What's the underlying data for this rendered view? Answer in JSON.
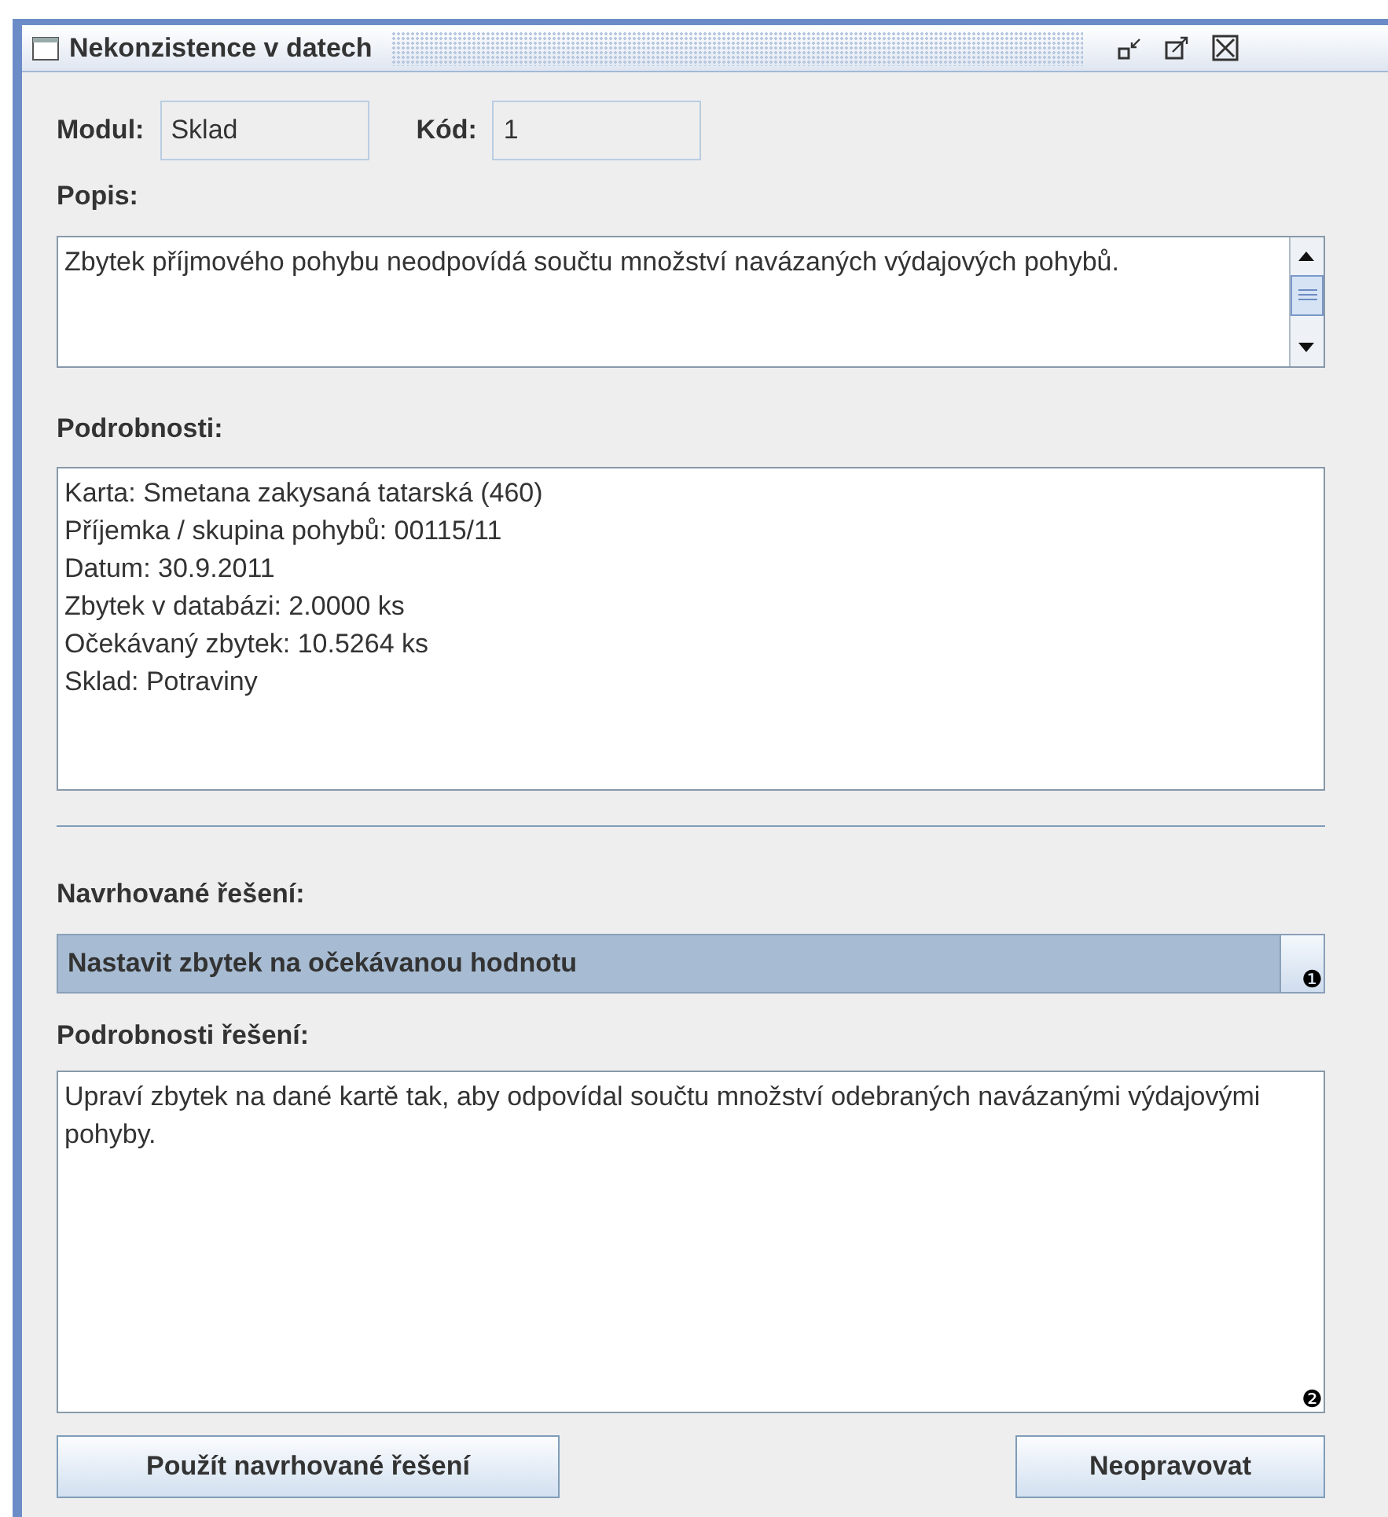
{
  "window": {
    "title": "Nekonzistence v datech"
  },
  "fields": [
    {
      "label": "Modul:",
      "value": "Sklad"
    },
    {
      "label": "Kód:",
      "value": "1"
    }
  ],
  "description": {
    "label": "Popis:",
    "text": "Zbytek příjmového pohybu neodpovídá součtu množství navázaných výdajových pohybů."
  },
  "details": {
    "label": "Podrobnosti:",
    "lines": [
      "Karta: Smetana zakysaná tatarská (460)",
      "Příjemka / skupina pohybů: 00115/11",
      "Datum: 30.9.2011",
      "Zbytek v databázi: 2.0000 ks",
      "Očekávaný zbytek: 10.5264 ks",
      "Sklad: Potraviny"
    ]
  },
  "solutions": {
    "label": "Navrhované řešení:",
    "selected": "Nastavit zbytek na očekávanou hodnotu",
    "marker": "❶"
  },
  "solution_details": {
    "label": "Podrobnosti řešení:",
    "text": "Upraví zbytek na dané kartě tak, aby odpovídal součtu množství odebraných navázanými výdajovými pohyby.",
    "marker": "❷"
  },
  "buttons": [
    "Použít navrhované řešení",
    "Neopravovat"
  ]
}
